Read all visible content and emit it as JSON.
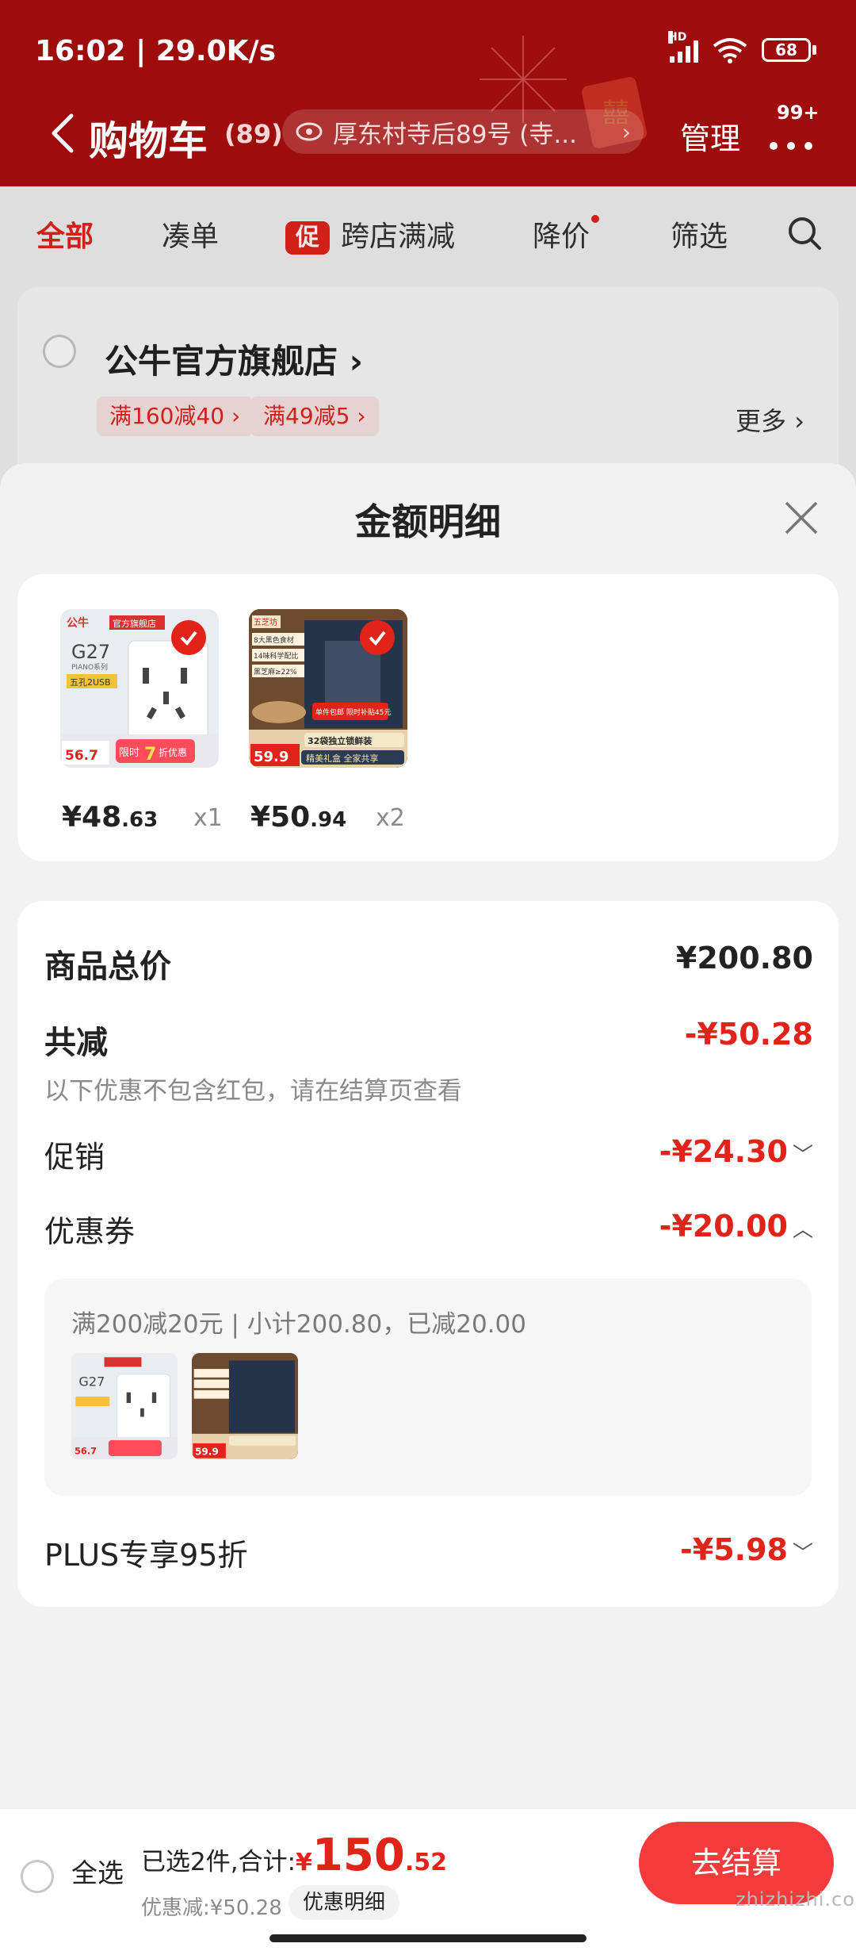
{
  "status_bar": {
    "time_speed": "16:02 | 29.0K/s",
    "network": "HD",
    "battery": "68"
  },
  "header": {
    "title": "购物车",
    "count": "(89)",
    "address": "厚东村寺后89号 (寺...",
    "manage": "管理",
    "badge": "99+"
  },
  "tabs": {
    "all": "全部",
    "combine": "凑单",
    "cross_tag": "促",
    "cross": "跨店满减",
    "price_drop": "降价",
    "filter": "筛选"
  },
  "store": {
    "name": "公牛官方旗舰店",
    "promo1": "满160减40",
    "promo2": "满49减5",
    "more": "更多"
  },
  "sheet": {
    "title": "金额明细",
    "products": [
      {
        "price_int": "¥48",
        "price_dec": ".63",
        "qty": "x1",
        "thumb_brand": "公牛",
        "thumb_tag": "官方旗舰店",
        "thumb_model": "G27",
        "thumb_series": "PIANO系列",
        "thumb_feature": "五孔2USB",
        "thumb_price": "56.7",
        "thumb_promo": "限时",
        "thumb_promo_num": "7",
        "thumb_promo_end": "折优惠"
      },
      {
        "price_int": "¥50",
        "price_dec": ".94",
        "qty": "x2",
        "thumb_brand": "五芝坊",
        "thumb_line1": "8大黑色食材",
        "thumb_line2": "14味科学配比",
        "thumb_line3": "黑芝麻≥22%",
        "thumb_price": "59.9",
        "thumb_banner": "32袋独立锁鲜装",
        "thumb_banner2": "精美礼盒 全家共享",
        "thumb_ship": "单件包邮 限时补贴45元"
      }
    ],
    "total_label": "商品总价",
    "total_value": "¥200.80",
    "reduce_label": "共减",
    "reduce_value": "-¥50.28",
    "reduce_note": "以下优惠不包含红包，请在结算页查看",
    "promo_label": "促销",
    "promo_value": "-¥24.30",
    "coupon_label": "优惠券",
    "coupon_value": "-¥20.00",
    "coupon_desc": "满200减20元 | 小计200.80，已减20.00",
    "plus_label": "PLUS专享95折",
    "plus_value": "-¥5.98"
  },
  "bottom": {
    "select_all": "全选",
    "selected": "已选2件,合计:",
    "yen": "¥",
    "amount_int": "150",
    "amount_dec": ".52",
    "discount": "优惠减:¥50.28",
    "detail_btn": "优惠明细",
    "checkout": "去结算",
    "watermark": "zhizhizhi.com"
  }
}
